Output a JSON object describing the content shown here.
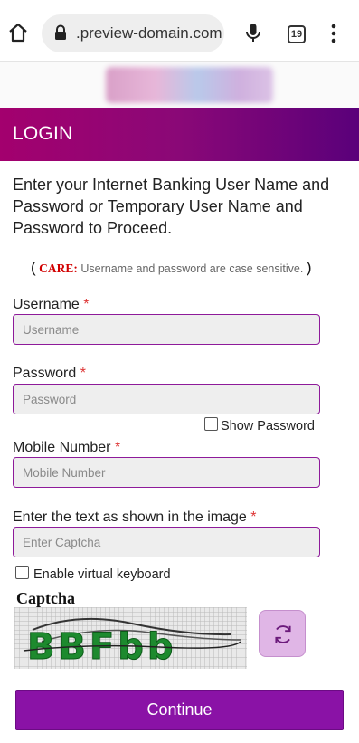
{
  "browser": {
    "url": ".preview-domain.com",
    "tab_count": "19"
  },
  "login": {
    "title": "LOGIN",
    "instructions": "Enter your Internet Banking User Name and Password or Temporary User Name and Password to Proceed.",
    "care_open": "(",
    "care_label": "CARE:",
    "care_text": " Username and password are case sensitive. ",
    "care_close": ")"
  },
  "fields": {
    "username": {
      "label": "Username ",
      "required": "*",
      "placeholder": "Username",
      "value": ""
    },
    "password": {
      "label": "Password ",
      "required": "*",
      "placeholder": "Password",
      "value": ""
    },
    "show_password": {
      "label": "Show Password",
      "checked": false
    },
    "mobile": {
      "label": "Mobile Number ",
      "required": "*",
      "placeholder": "Mobile Number",
      "value": ""
    },
    "captcha": {
      "label": "Enter the text as shown in the image ",
      "required": "*",
      "placeholder": "Enter Captcha",
      "value": ""
    },
    "virtual_keyboard": {
      "label": "Enable virtual keyboard",
      "checked": false
    }
  },
  "captcha_block": {
    "title": "Captcha",
    "image_text": "BBFbb"
  },
  "actions": {
    "continue_label": "Continue"
  },
  "colors": {
    "brand": "#8a12a6",
    "header_start": "#a3006e",
    "header_end": "#5a007a",
    "required": "#d33",
    "care": "#d10000"
  },
  "icons": {
    "home": "home-icon",
    "lock": "lock-icon",
    "mic": "mic-icon",
    "menu": "more-vert-icon",
    "refresh": "refresh-icon"
  }
}
